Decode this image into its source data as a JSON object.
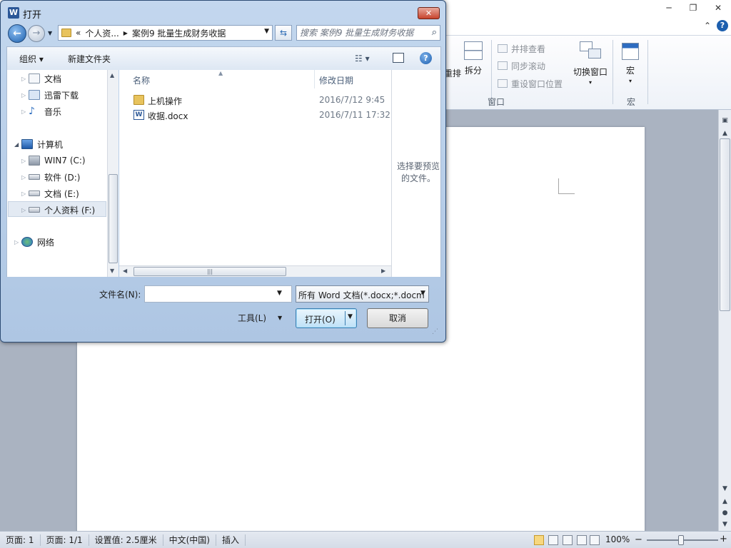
{
  "word": {
    "minimize_glyph": "─",
    "restore_glyph": "❐",
    "close_glyph": "✕",
    "ribbon_collapse_glyph": "⌃",
    "help_glyph": "?",
    "ribbon": {
      "partial_label": "重排",
      "split_label": "拆分",
      "side_by_side": "并排查看",
      "sync_scroll": "同步滚动",
      "reset_position": "重设窗口位置",
      "switch_windows": "切换窗口",
      "macro_label": "宏",
      "window_group": "窗口",
      "macro_group": "宏"
    },
    "status": {
      "page": "页面: 1",
      "pages": "页面: 1/1",
      "setting": "设置值: 2.5厘米",
      "language": "中文(中国)",
      "mode": "插入",
      "zoom": "100%",
      "zoom_minus": "−",
      "zoom_plus": "+"
    }
  },
  "dialog": {
    "title": "打开",
    "app_icon_letter": "W",
    "breadcrumb": [
      "«",
      "个人资...",
      "案例9 批量生成财务收据"
    ],
    "search_placeholder": "搜索 案例9 批量生成财务收据",
    "toolbar": {
      "organize": "组织 ▾",
      "new_folder": "新建文件夹"
    },
    "nav_tree": [
      {
        "label": "文档",
        "icon": "documents-icon"
      },
      {
        "label": "迅雷下载",
        "icon": "downloads-icon"
      },
      {
        "label": "音乐",
        "icon": "music-icon"
      },
      {
        "label": "计算机",
        "icon": "computer-icon"
      },
      {
        "label": "WIN7 (C:)",
        "icon": "system-drive-icon"
      },
      {
        "label": "软件 (D:)",
        "icon": "drive-icon"
      },
      {
        "label": "文档 (E:)",
        "icon": "drive-icon"
      },
      {
        "label": "个人资料 (F:)",
        "icon": "drive-icon"
      },
      {
        "label": "网络",
        "icon": "network-icon"
      }
    ],
    "columns": {
      "name": "名称",
      "modified": "修改日期"
    },
    "files": [
      {
        "name": "上机操作",
        "date": "2016/7/12 9:45",
        "icon": "folder-icon"
      },
      {
        "name": "收据.docx",
        "date": "2016/7/11 17:32",
        "icon": "word-doc-icon"
      }
    ],
    "preview_text": "选择要预览的文件。",
    "filename_label": "文件名(N):",
    "filename_value": "",
    "filter_value": "所有 Word 文档(*.docx;*.docm",
    "tools_label": "工具(L)",
    "open_label": "打开(O)",
    "cancel_label": "取消"
  }
}
